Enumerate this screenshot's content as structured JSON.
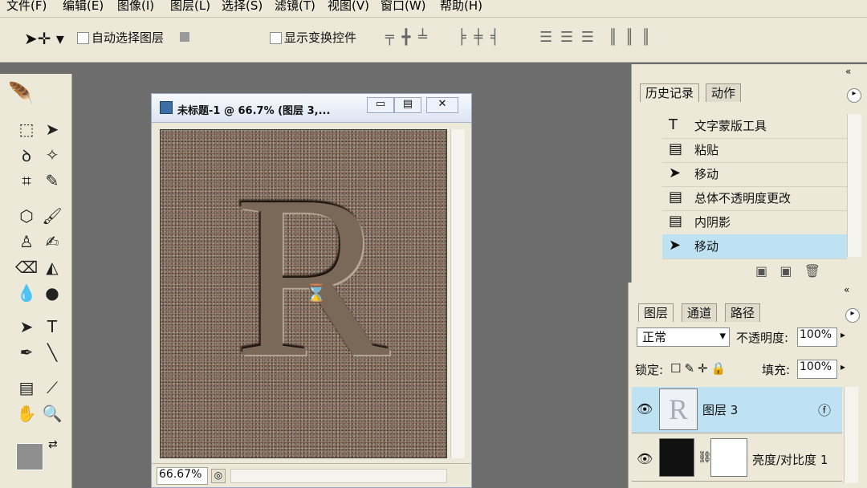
{
  "menubar": {
    "items": [
      "文件(F)",
      "编辑(E)",
      "图像(I)",
      "图层(L)",
      "选择(S)",
      "滤镜(T)",
      "视图(V)",
      "窗口(W)",
      "帮助(H)"
    ]
  },
  "options_bar": {
    "auto_select_label": "自动选择图层",
    "show_transform_label": "显示变换控件"
  },
  "document": {
    "title": "未标题-1 @ 66.7% (图层 3,...",
    "canvas_letter": "R",
    "zoom": "66.67%"
  },
  "history_panel": {
    "tabs": [
      "历史记录",
      "动作"
    ],
    "items": [
      {
        "icon": "text-tool-icon",
        "label": "文字蒙版工具"
      },
      {
        "icon": "history-state-icon",
        "label": "粘贴"
      },
      {
        "icon": "move-tool-icon",
        "label": "移动"
      },
      {
        "icon": "history-state-icon",
        "label": "总体不透明度更改"
      },
      {
        "icon": "history-state-icon",
        "label": "内阴影"
      },
      {
        "icon": "move-tool-icon",
        "label": "移动"
      }
    ]
  },
  "layers_panel": {
    "tabs": [
      "图层",
      "通道",
      "路径"
    ],
    "blend_mode": "正常",
    "opacity_label": "不透明度:",
    "opacity_value": "100%",
    "lock_label": "锁定:",
    "fill_label": "填充:",
    "fill_value": "100%",
    "layers": [
      {
        "name": "图层 3"
      },
      {
        "name": "亮度/对比度 1"
      }
    ]
  },
  "colors": {
    "chrome": "#ece9d8",
    "workspace": "#6d6d6d",
    "selection": "#bfe2f2"
  }
}
